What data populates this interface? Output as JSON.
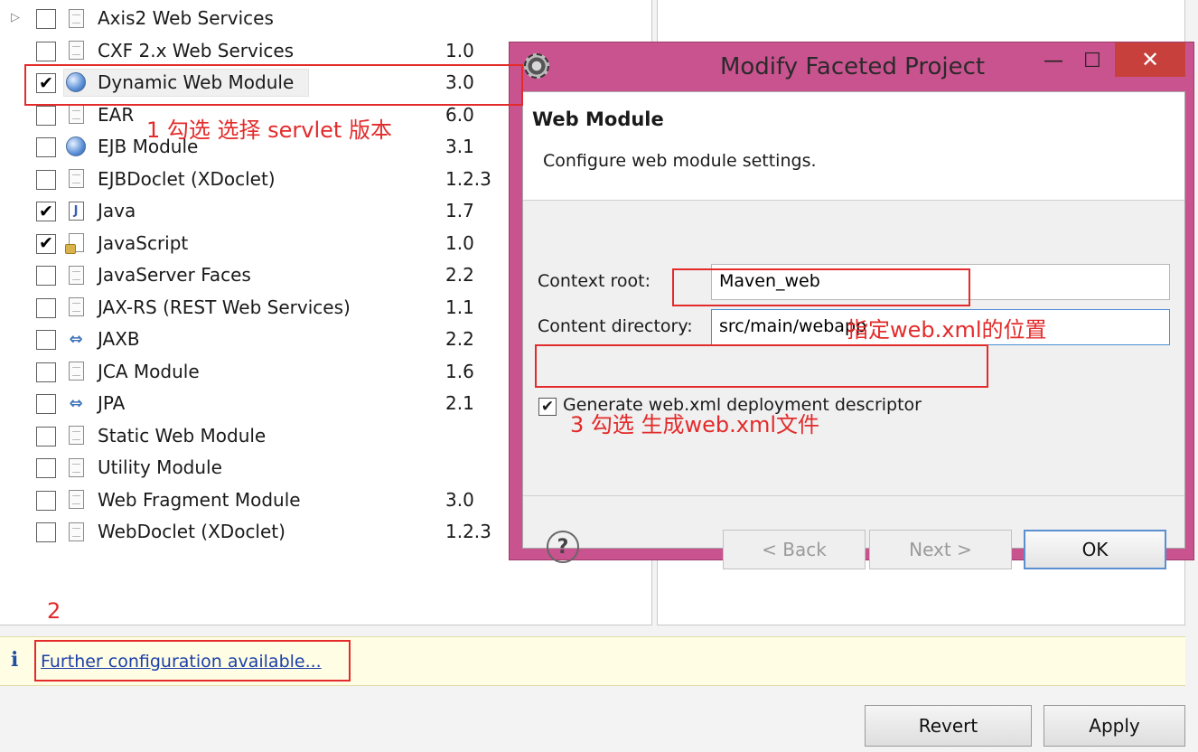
{
  "facets": [
    {
      "name": "Axis2 Web Services",
      "version": "",
      "checked": false,
      "icon": "document-icon",
      "expander": "▷"
    },
    {
      "name": "CXF 2.x Web Services",
      "version": "1.0",
      "checked": false,
      "icon": "document-icon"
    },
    {
      "name": "Dynamic Web Module",
      "version": "3.0",
      "checked": true,
      "icon": "web-module-icon",
      "selected": true
    },
    {
      "name": "EAR",
      "version": "6.0",
      "checked": false,
      "icon": "document-icon"
    },
    {
      "name": "EJB Module",
      "version": "3.1",
      "checked": false,
      "icon": "ejb-module-icon"
    },
    {
      "name": "EJBDoclet (XDoclet)",
      "version": "1.2.3",
      "checked": false,
      "icon": "document-icon"
    },
    {
      "name": "Java",
      "version": "1.7",
      "checked": true,
      "icon": "java-icon"
    },
    {
      "name": "JavaScript",
      "version": "1.0",
      "checked": true,
      "icon": "javascript-icon"
    },
    {
      "name": "JavaServer Faces",
      "version": "2.2",
      "checked": false,
      "icon": "document-icon"
    },
    {
      "name": "JAX-RS (REST Web Services)",
      "version": "1.1",
      "checked": false,
      "icon": "document-icon"
    },
    {
      "name": "JAXB",
      "version": "2.2",
      "checked": false,
      "icon": "arrows-icon"
    },
    {
      "name": "JCA Module",
      "version": "1.6",
      "checked": false,
      "icon": "document-icon"
    },
    {
      "name": "JPA",
      "version": "2.1",
      "checked": false,
      "icon": "arrows-icon"
    },
    {
      "name": "Static Web Module",
      "version": "",
      "checked": false,
      "icon": "document-icon"
    },
    {
      "name": "Utility Module",
      "version": "",
      "checked": false,
      "icon": "document-icon"
    },
    {
      "name": "Web Fragment Module",
      "version": "3.0",
      "checked": false,
      "icon": "document-icon"
    },
    {
      "name": "WebDoclet (XDoclet)",
      "version": "1.2.3",
      "checked": false,
      "icon": "document-icon"
    }
  ],
  "info_bar": {
    "icon": "i",
    "link": "Further configuration available..."
  },
  "buttons": {
    "revert": "Revert",
    "apply": "Apply"
  },
  "dialog": {
    "title": "Modify Faceted Project",
    "minimize": "—",
    "maximize": "☐",
    "close": "✕",
    "header_title": "Web Module",
    "header_desc": "Configure web module settings.",
    "context_root_label": "Context root:",
    "context_root_value": "Maven_web",
    "content_dir_label": "Content directory:",
    "content_dir_value": "src/main/webapp",
    "generate_label": "Generate web.xml deployment descriptor",
    "generate_checked": true,
    "help": "?",
    "back": "< Back",
    "next": "Next >",
    "ok": "OK"
  },
  "annotations": {
    "step1": "1 勾选 选择 servlet 版本",
    "step2": "2",
    "webxml_location": "指定web.xml的位置",
    "step3": "3 勾选 生成web.xml文件"
  },
  "colors": {
    "dialog_frame": "#c9538f",
    "annotation": "#e32b2b",
    "close_button": "#c7403c",
    "info_bar": "#fffde4"
  }
}
